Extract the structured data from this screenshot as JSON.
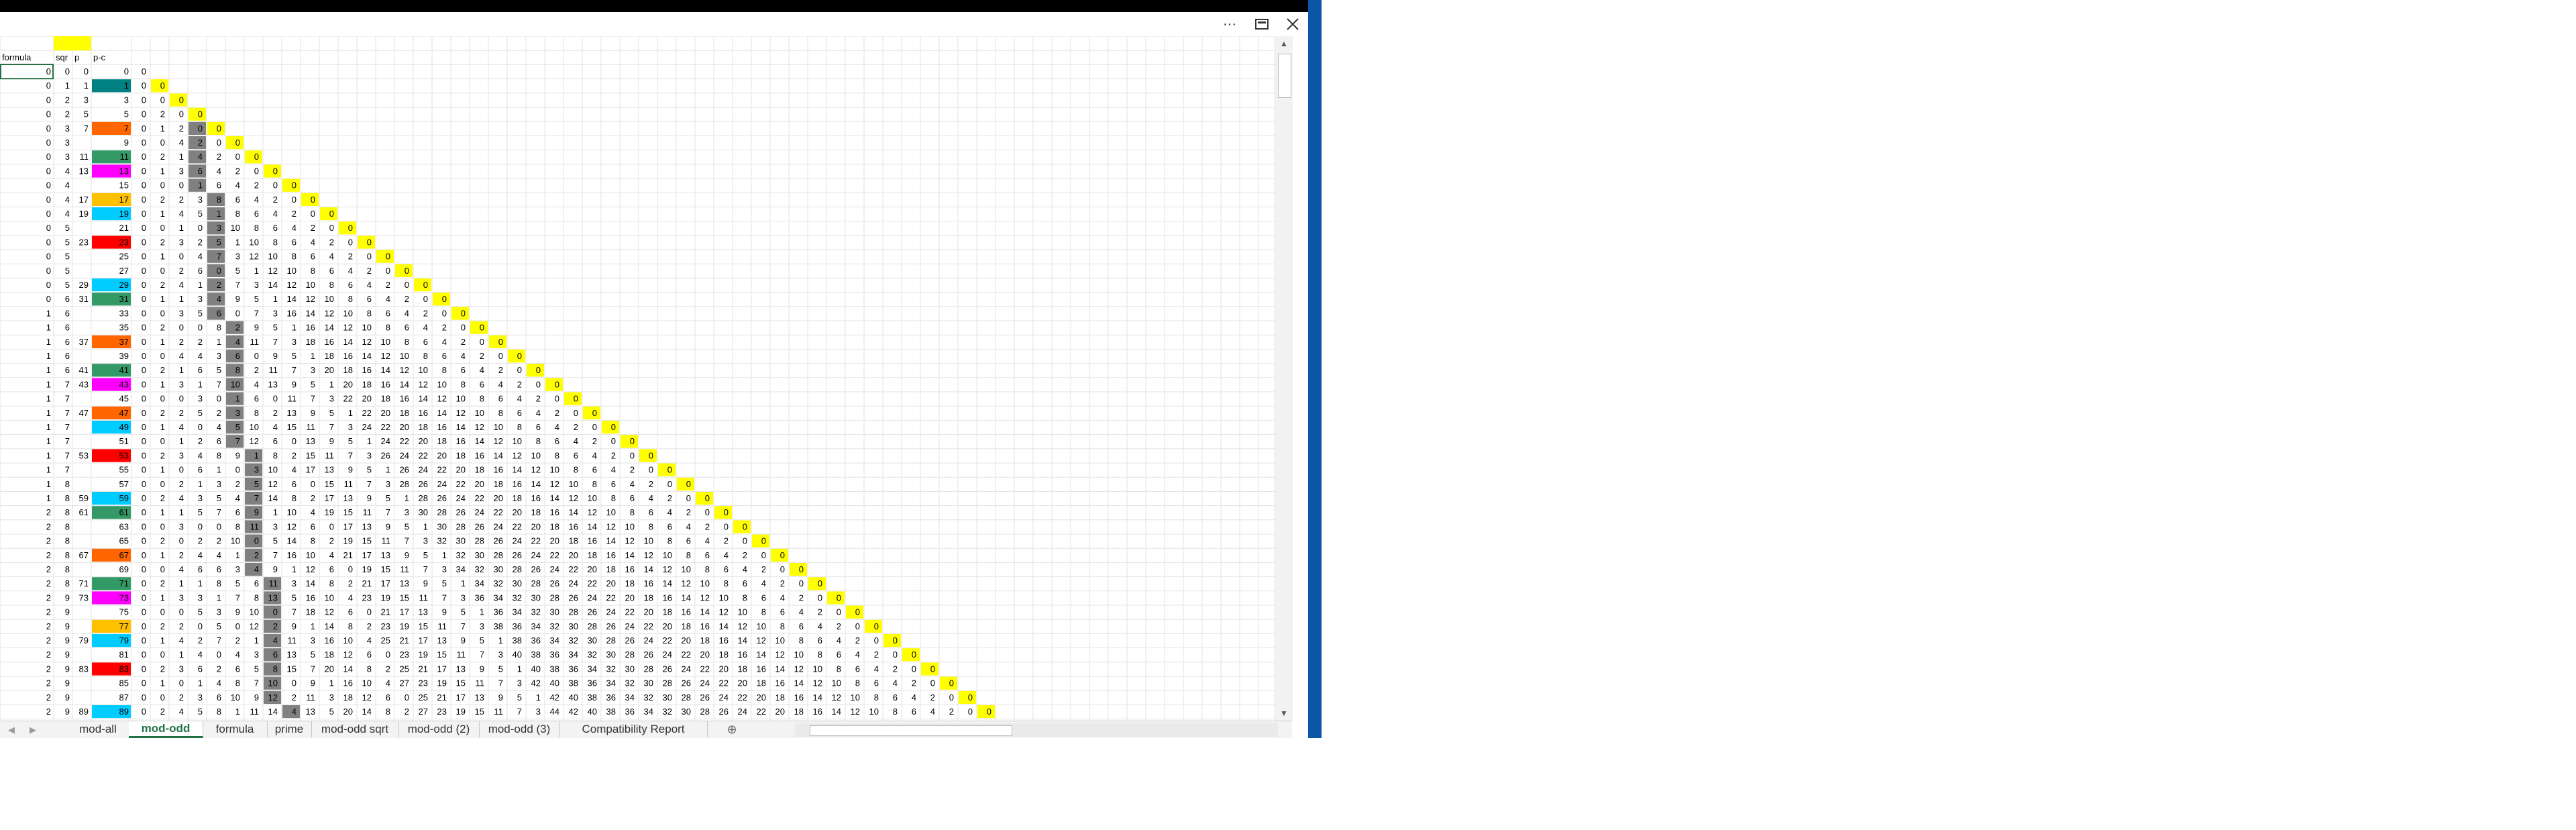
{
  "window": {
    "more_icon": "ellipsis-icon",
    "restore_icon": "restore-icon",
    "close_icon": "close-icon"
  },
  "headers": {
    "formula": "formula",
    "sqr": "sqr",
    "p": "p",
    "pc": "p-c"
  },
  "rows": [
    [
      0,
      0,
      0,
      0
    ],
    [
      0,
      1,
      1,
      1
    ],
    [
      0,
      2,
      3,
      3
    ],
    [
      0,
      2,
      5,
      5
    ],
    [
      0,
      3,
      7,
      7
    ],
    [
      0,
      3,
      "",
      9
    ],
    [
      0,
      3,
      11,
      11
    ],
    [
      0,
      4,
      13,
      13
    ],
    [
      0,
      4,
      "",
      15
    ],
    [
      0,
      4,
      17,
      17
    ],
    [
      0,
      4,
      19,
      19
    ],
    [
      0,
      5,
      "",
      21
    ],
    [
      0,
      5,
      23,
      23
    ],
    [
      0,
      5,
      "",
      25
    ],
    [
      0,
      5,
      "",
      27
    ],
    [
      0,
      5,
      29,
      29
    ],
    [
      0,
      6,
      31,
      31
    ],
    [
      1,
      6,
      "",
      33
    ],
    [
      1,
      6,
      "",
      35
    ],
    [
      1,
      6,
      37,
      37
    ],
    [
      1,
      6,
      "",
      39
    ],
    [
      1,
      6,
      41,
      41
    ],
    [
      1,
      7,
      43,
      43
    ],
    [
      1,
      7,
      "",
      45
    ],
    [
      1,
      7,
      47,
      47
    ],
    [
      1,
      7,
      "",
      49
    ],
    [
      1,
      7,
      "",
      51
    ],
    [
      1,
      7,
      53,
      53
    ],
    [
      1,
      7,
      "",
      55
    ],
    [
      1,
      8,
      "",
      57
    ],
    [
      1,
      8,
      59,
      59
    ],
    [
      2,
      8,
      61,
      61
    ],
    [
      2,
      8,
      "",
      63
    ],
    [
      2,
      8,
      "",
      65
    ],
    [
      2,
      8,
      67,
      67
    ],
    [
      2,
      8,
      "",
      69
    ],
    [
      2,
      8,
      71,
      71
    ],
    [
      2,
      9,
      73,
      73
    ],
    [
      2,
      9,
      "",
      75
    ],
    [
      2,
      9,
      "",
      77
    ],
    [
      2,
      9,
      79,
      79
    ],
    [
      2,
      9,
      "",
      81
    ],
    [
      2,
      9,
      83,
      83
    ],
    [
      2,
      9,
      "",
      85
    ],
    [
      2,
      9,
      "",
      87
    ],
    [
      2,
      9,
      89,
      89
    ]
  ],
  "colors": {
    "yellow": "#ffff00",
    "teal": "#008080",
    "orange": "#ff6600",
    "cyan": "#00ccff",
    "magenta": "#ff00ff",
    "red": "#ff0000",
    "green": "#339966",
    "gold": "#ffc000",
    "gray": "#808080",
    "selection": "#217346"
  },
  "sheet_tabs": [
    "mod-all",
    "mod-odd",
    "formula",
    "prime",
    "mod-odd sqrt",
    "mod-odd (2)",
    "mod-odd (3)",
    "Compatibility Report"
  ],
  "active_tab": "mod-odd",
  "nav": {
    "prev_icon": "chevron-left-icon",
    "next_icon": "chevron-right-icon",
    "add_sheet_icon": "plus-circle-icon"
  }
}
